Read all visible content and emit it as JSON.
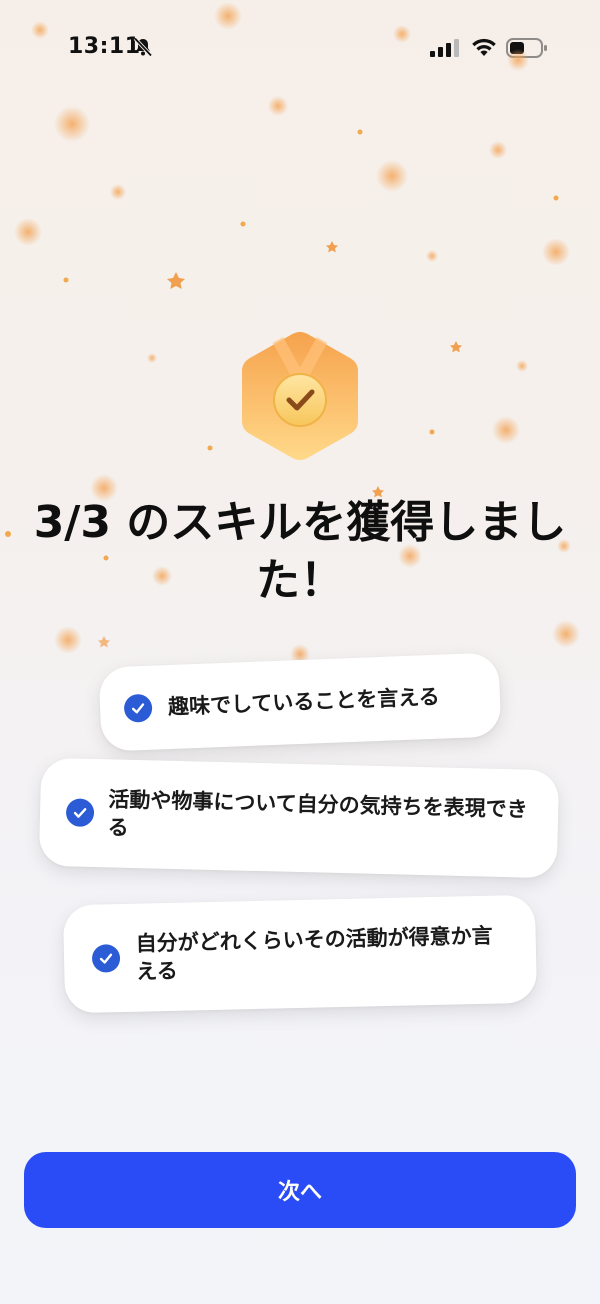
{
  "status_bar": {
    "time": "13:11",
    "icons": [
      "bell-slash-icon",
      "cellular-signal-icon",
      "wifi-icon",
      "battery-icon"
    ]
  },
  "badge": {
    "icon": "medal-check-icon"
  },
  "headline": "3/3 のスキルを獲得しました！",
  "skills": [
    {
      "label": "趣味でしていることを言える",
      "checked": true
    },
    {
      "label": "活動や物事について自分の気持ちを表現できる",
      "checked": true
    },
    {
      "label": "自分がどれくらいその活動が得意か言える",
      "checked": true
    }
  ],
  "next_button": {
    "label": "次へ"
  },
  "colors": {
    "accent": "#2a4cf6",
    "check": "#2c5bd6",
    "badge_top": "#f6a24c",
    "badge_bottom": "#ffd98a",
    "confetti": "#f3a85e"
  }
}
